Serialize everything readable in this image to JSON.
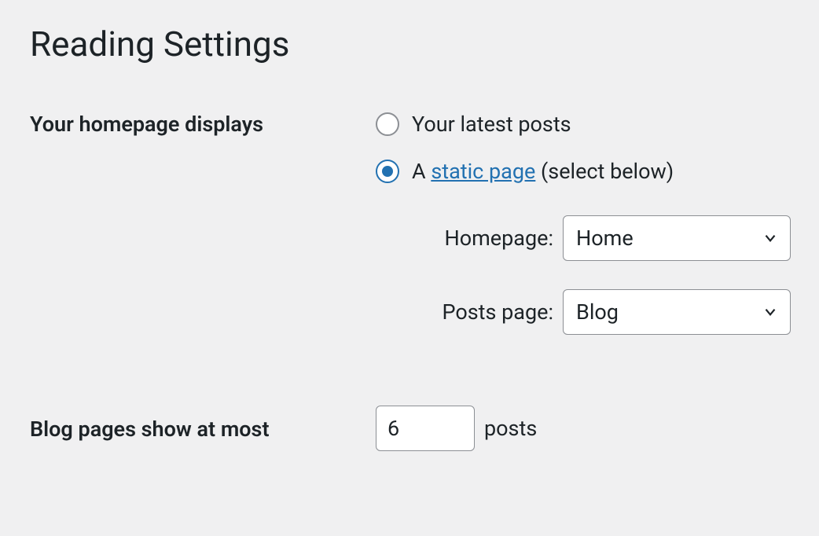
{
  "page": {
    "title": "Reading Settings"
  },
  "homepage": {
    "label": "Your homepage displays",
    "option_latest": "Your latest posts",
    "option_static_prefix": "A ",
    "option_static_link": "static page",
    "option_static_suffix": " (select below)",
    "homepage_label": "Homepage:",
    "homepage_value": "Home",
    "postspage_label": "Posts page:",
    "postspage_value": "Blog"
  },
  "blogpages": {
    "label": "Blog pages show at most",
    "value": "6",
    "suffix": "posts"
  }
}
